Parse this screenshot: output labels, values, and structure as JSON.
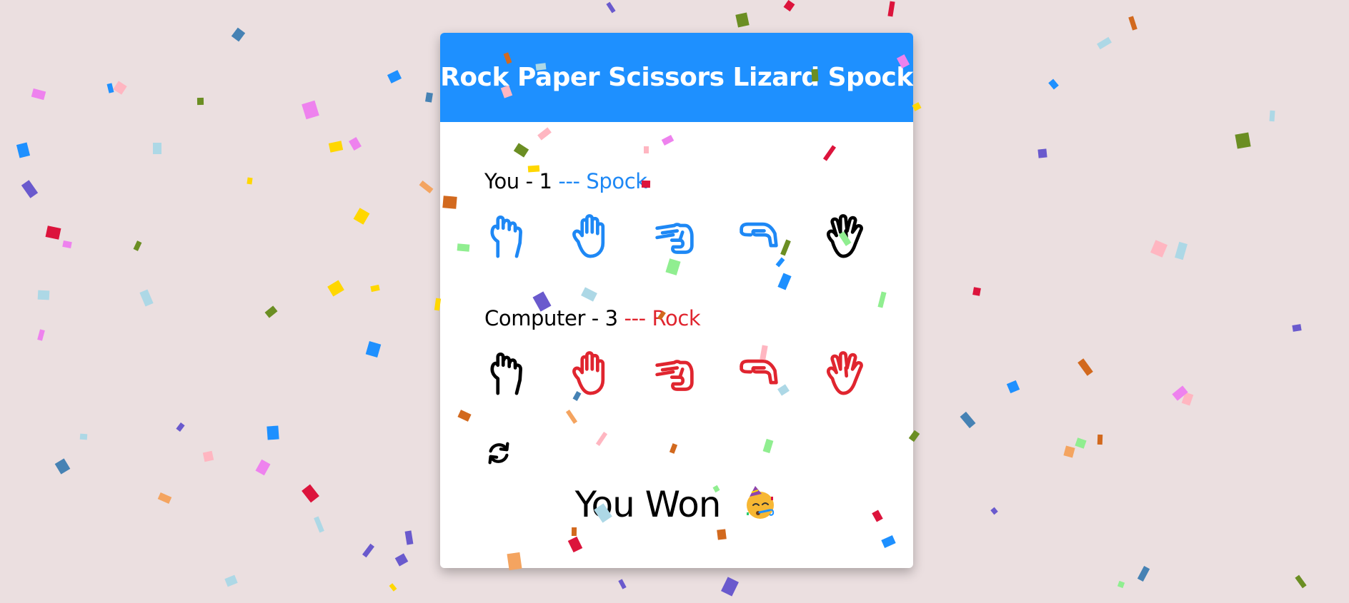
{
  "title": "Rock Paper Scissors Lizard Spock",
  "colors": {
    "header": "#1e90ff",
    "player_accent": "#1e88f5",
    "computer_accent": "#e0252f",
    "selected": "#000000",
    "background": "#ebdfe0"
  },
  "player": {
    "label": "You - 1",
    "choice_text": "--- Spock",
    "selected": "spock"
  },
  "computer": {
    "label": "Computer - 3",
    "choice_text": "--- Rock",
    "selected": "rock"
  },
  "choices": [
    {
      "id": "rock",
      "icon": "hand-rock-icon"
    },
    {
      "id": "paper",
      "icon": "hand-paper-icon"
    },
    {
      "id": "scissors",
      "icon": "hand-scissors-icon"
    },
    {
      "id": "lizard",
      "icon": "hand-lizard-icon"
    },
    {
      "id": "spock",
      "icon": "hand-spock-icon"
    }
  ],
  "reset": {
    "icon": "refresh-icon"
  },
  "result": {
    "text": "You Won",
    "emoji": "partying-face-emoji"
  },
  "confetti_colors": [
    "#ffd700",
    "#1e90ff",
    "#dc143c",
    "#6b8e23",
    "#ffb6c1",
    "#add8e6",
    "#d2691e",
    "#6a5acd",
    "#ee82ee",
    "#f4a460",
    "#90ee90",
    "#4682b4"
  ]
}
